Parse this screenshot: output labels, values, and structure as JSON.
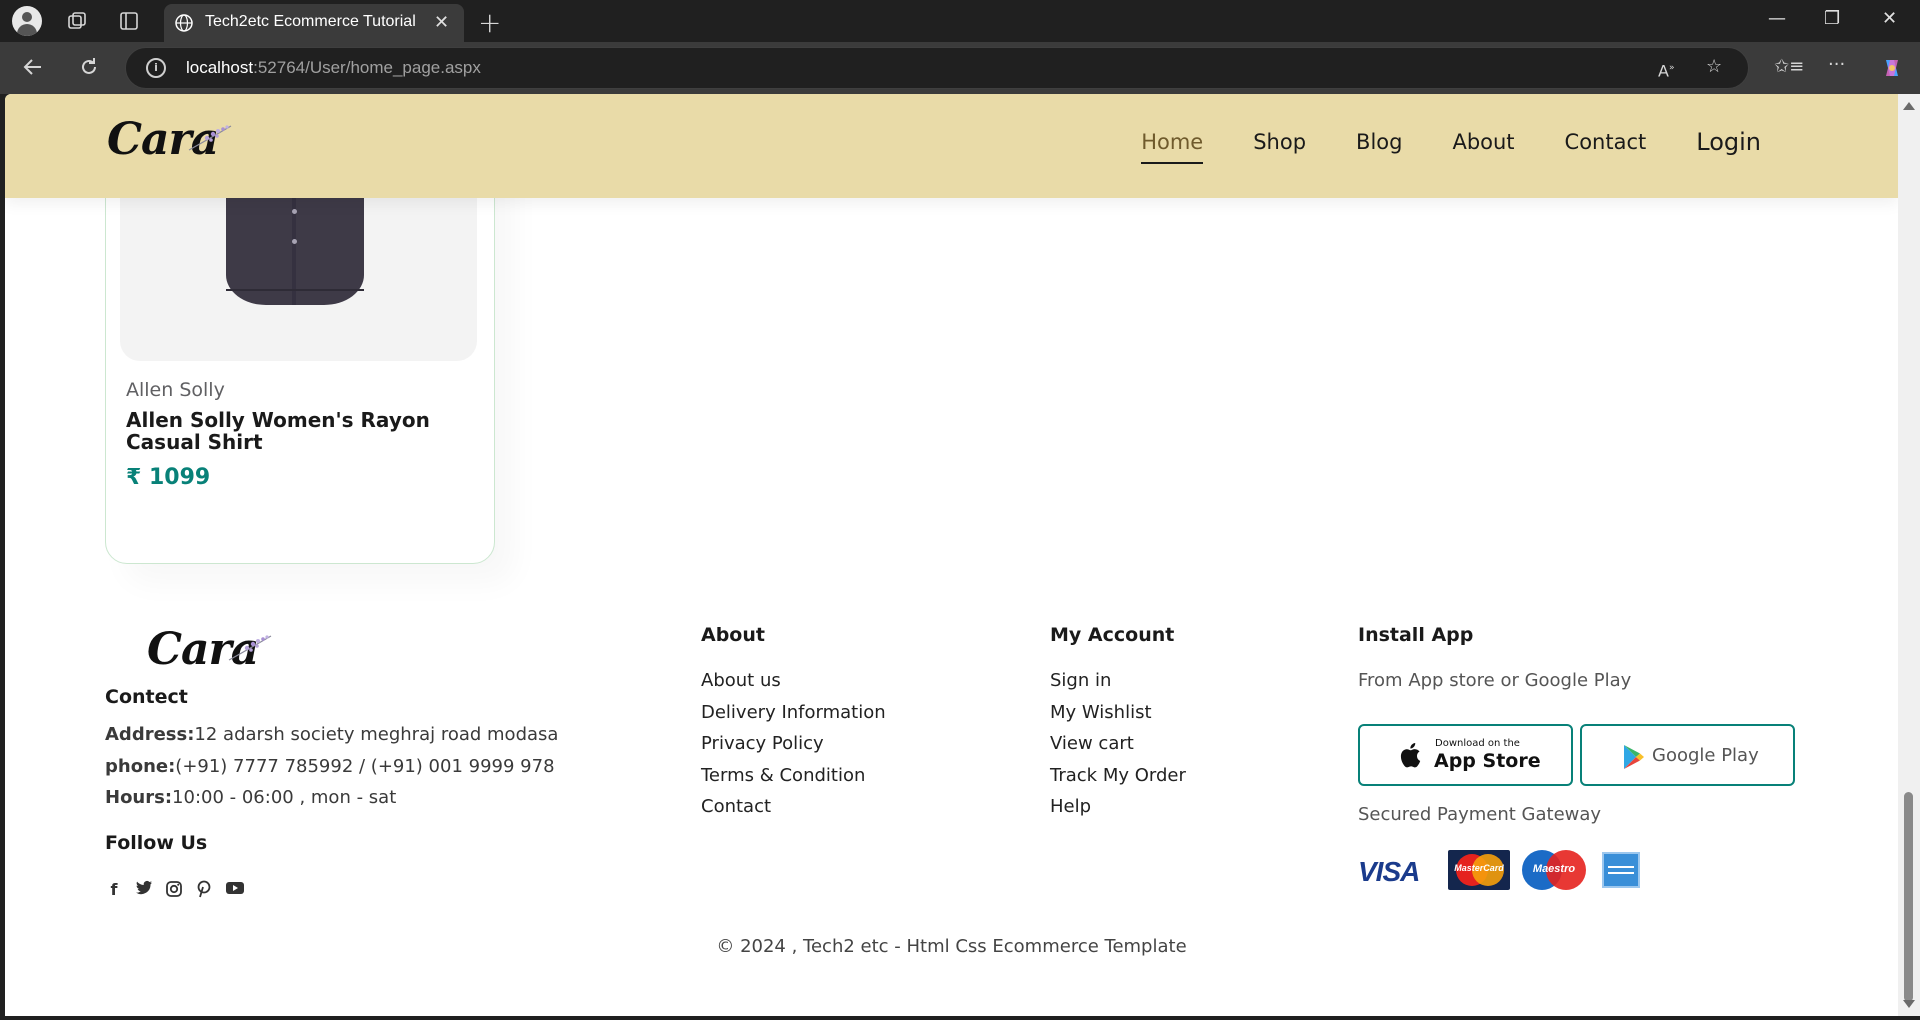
{
  "browser": {
    "tab_title": "Tech2etc Ecommerce Tutorial",
    "url_host": "localhost",
    "url_rest": ":52764/User/home_page.aspx"
  },
  "site": {
    "logo": "Cara",
    "nav": [
      "Home",
      "Shop",
      "Blog",
      "About",
      "Contact",
      "Login"
    ],
    "active_nav": "Home"
  },
  "product": {
    "brand": "Allen Solly",
    "name": "Allen Solly Women's Rayon Casual Shirt",
    "price": "₹ 1099"
  },
  "footer": {
    "logo": "Cara",
    "contact_heading": "Contect",
    "address_label": "Address:",
    "address_value": "12 adarsh society meghraj road modasa",
    "phone_label": "phone:",
    "phone_value": "(+91) 7777 785992 / (+91) 001 9999 978",
    "hours_label": "Hours:",
    "hours_value": "10:00 - 06:00 , mon - sat",
    "follow_heading": "Follow Us",
    "about_heading": "About",
    "about_links": [
      "About us",
      "Delivery Information",
      "Privacy Policy",
      "Terms & Condition",
      "Contact"
    ],
    "account_heading": "My Account",
    "account_links": [
      "Sign in",
      "My Wishlist",
      "View cart",
      "Track My Order",
      "Help"
    ],
    "install_heading": "Install App",
    "install_sub": "From App store or Google Play",
    "appstore_small": "Download on the",
    "appstore_big": "App Store",
    "googleplay": "Google Play",
    "payment_heading": "Secured Payment Gateway",
    "payment_visa": "VISA",
    "payment_mastercard": "MasterCard",
    "payment_maestro": "Maestro",
    "copyright": "© 2024 , Tech2 etc - Html Css Ecommerce Template"
  },
  "colors": {
    "header_bg": "#e9dba8",
    "accent": "#088178"
  }
}
